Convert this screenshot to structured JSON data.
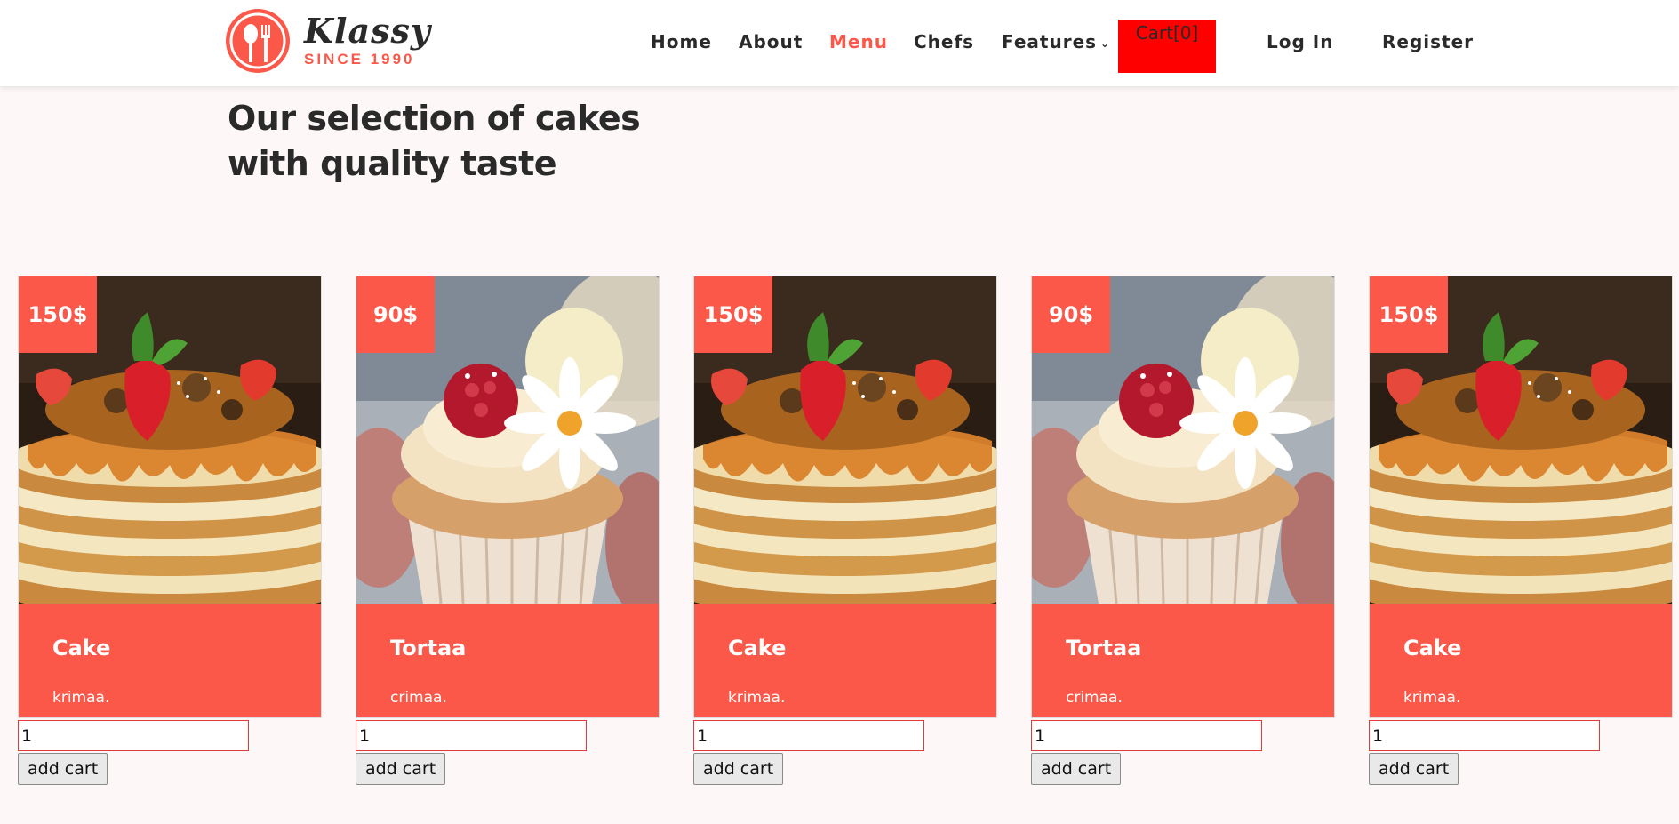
{
  "brand": {
    "name": "Klassy",
    "since": "SINCE 1990"
  },
  "nav": {
    "home": "Home",
    "about": "About",
    "menu": "Menu",
    "chefs": "Chefs",
    "features": "Features",
    "cart": "Cart[0]",
    "login": "Log In",
    "register": "Register"
  },
  "section": {
    "title_line1": "Our selection of cakes",
    "title_line2": "with quality taste"
  },
  "colors": {
    "accent": "#fb5849",
    "cart_bg": "#ff0000"
  },
  "products": [
    {
      "price": "150$",
      "name": "Cake",
      "desc": "krimaa.",
      "qty": "1",
      "button": "add cart",
      "photo": "pancake-stack-photo"
    },
    {
      "price": "90$",
      "name": "Tortaa",
      "desc": "crimaa.",
      "qty": "1",
      "button": "add cart",
      "photo": "cupcake-photo"
    },
    {
      "price": "150$",
      "name": "Cake",
      "desc": "krimaa.",
      "qty": "1",
      "button": "add cart",
      "photo": "pancake-stack-photo"
    },
    {
      "price": "90$",
      "name": "Tortaa",
      "desc": "crimaa.",
      "qty": "1",
      "button": "add cart",
      "photo": "cupcake-photo"
    },
    {
      "price": "150$",
      "name": "Cake",
      "desc": "krimaa.",
      "qty": "1",
      "button": "add cart",
      "photo": "pancake-stack-photo"
    }
  ]
}
